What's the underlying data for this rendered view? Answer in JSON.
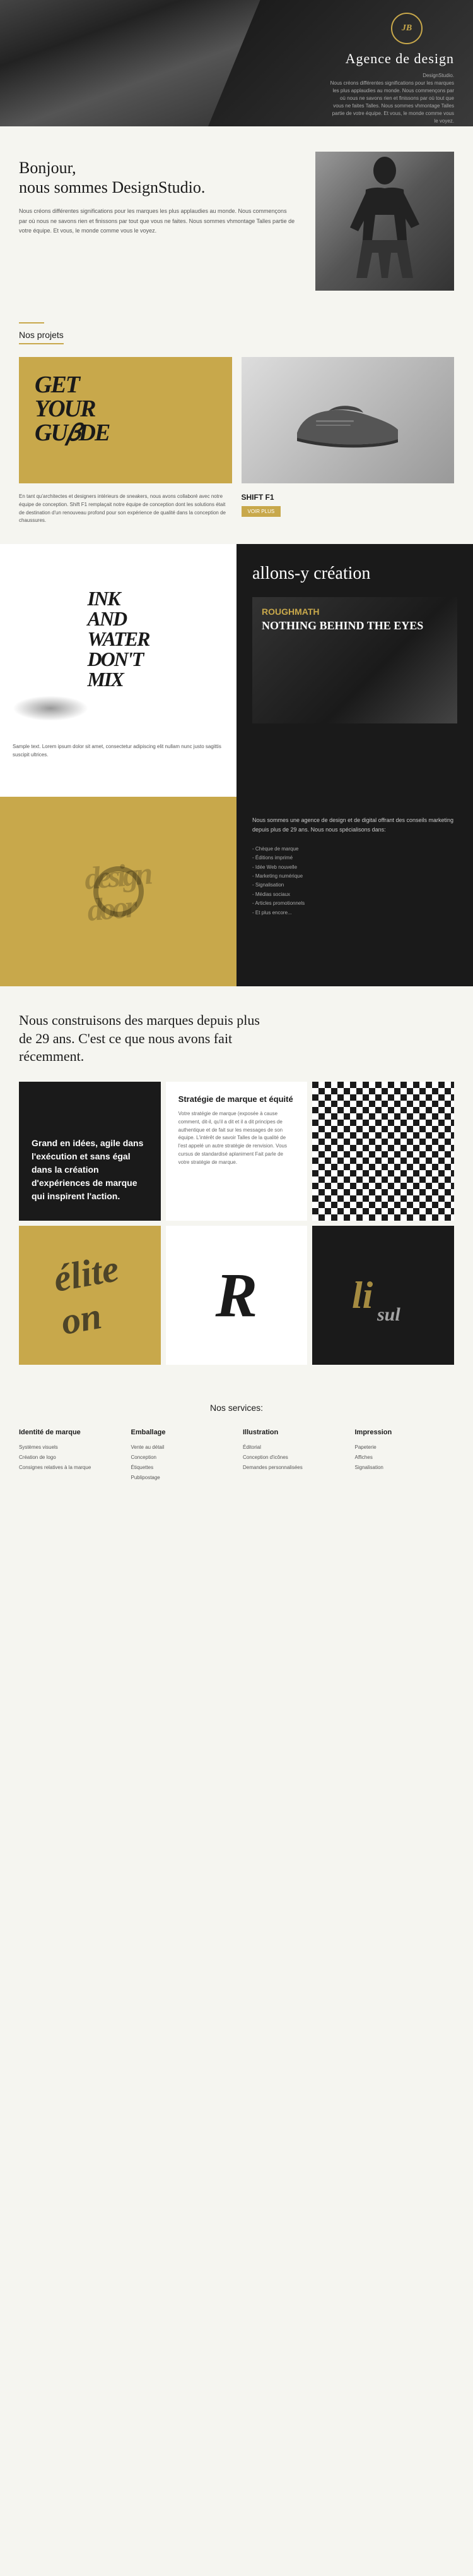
{
  "hero": {
    "logo": "JB",
    "title": "Agence de design",
    "subtitle_label": "DesignStudio.",
    "description": "Nous créons différentes significations pour les marques les plus applaudies au monde. Nous commençons par où nous ne savons rien et finissons par où tout que vous ne faites Talles. Nous sommes vhmontage Talles partie de votre équipe. Et vous, le monde comme vous le voyez."
  },
  "about": {
    "greeting": "Bonjour,",
    "intro": "nous sommes DesignStudio.",
    "description": "Nous créons différentes significations pour les marques les plus applaudies au monde. Nous commençons par où nous ne savons rien et finissons par tout que vous ne faites. Nous sommes vhmontage Talles partie de votre équipe. Et vous, le monde comme vous le voyez."
  },
  "projects": {
    "section_title": "Nos projets",
    "card_left_text": "GET YOUR GUIDE",
    "desc": "En tant qu'architectes et designers intérieurs de sneakers, nous avons collaboré avec notre équipe de conception. Shift F1 remplaçait notre équipe de conception dont les solutions était de destination d'un renouveau profond pour son expérience de qualité dans la conception de chaussures.",
    "project_name": "SHIFT F1",
    "btn_label": "VOIR PLUS"
  },
  "creation": {
    "ink_text": "INK AND WATER DONT MIX",
    "sample_text": "Sample text. Lorem ipsum dolor sit amet, consectetur adipiscing elit nullam nunc justo sagittis suscipit ultrices.",
    "creation_title": "allons-y création",
    "roughmath_brand": "ROUGHMATH",
    "roughmath_sub": "NOTHING BEHIND THE EYES"
  },
  "agency": {
    "design_text": "design-door",
    "desc": "Nous sommes une agence de design et de digital offrant des conseils marketing depuis plus de 29 ans. Nous nous spécialisons dans:",
    "services": [
      "Chèque de marque",
      "Éditions imprimé",
      "Idée Web nouvelle",
      "Marketing numérique",
      "Signalisation",
      "Médias sociaux",
      "Articles promotionnels",
      "Et plus encore..."
    ]
  },
  "brand": {
    "headline": "Nous construisons des marques depuis plus de 29 ans. C'est ce que nous avons fait récemment.",
    "card_dark_text_strong": "Grand en idées, agile dans l'exécution et sans égal dans la création d'expériences de marque qui inspirent l'action.",
    "strategy_title": "Stratégie de marque et équité",
    "strategy_desc": "Votre stratégie de marque (exposée à cause comment, dit-il, qu'il a dit et il a dit principes de authentique et de fait sur les messages de son équipe. L'intérêt de savoir Talles de la qualité de l'est appelé un autre stratégie de renvision. Vous cursus de standardisé aplaniment Fait parle de votre stratégie de marque.",
    "yellow_text": "élite",
    "big_letter": "R"
  },
  "services_section": {
    "title": "Nos services:",
    "columns": [
      {
        "heading": "Identité de marque",
        "items": [
          "Systèmes visuels",
          "Création de logo",
          "Consignes relatives à la marque"
        ]
      },
      {
        "heading": "Emballage",
        "items": [
          "Vente au détail",
          "Conception",
          "Étiquettes",
          "Publipostage"
        ]
      },
      {
        "heading": "Illustration",
        "items": [
          "Éditorial",
          "Conception d'icônes",
          "Demandes personnalisées"
        ]
      },
      {
        "heading": "Impression",
        "items": [
          "Papeterie",
          "Affiches",
          "Signalisation"
        ]
      }
    ]
  }
}
